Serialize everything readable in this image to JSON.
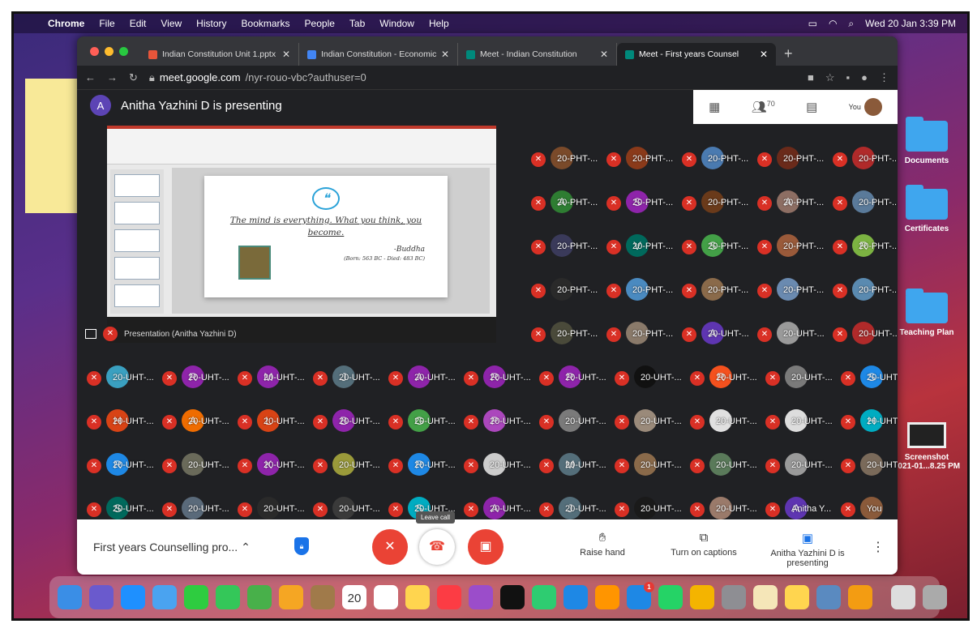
{
  "menubar": {
    "app": "Chrome",
    "items": [
      "File",
      "Edit",
      "View",
      "History",
      "Bookmarks",
      "People",
      "Tab",
      "Window",
      "Help"
    ],
    "datetime": "Wed 20 Jan  3:39 PM"
  },
  "desktop": {
    "items": [
      "Documents",
      "Certificates",
      "Teaching Plan",
      "Screenshot\n2021-01...8.25 PM"
    ]
  },
  "tabs": [
    {
      "title": "Indian Constitution Unit 1.pptx",
      "color": "#e8553a"
    },
    {
      "title": "Indian Constitution - Economic",
      "color": "#4285f4"
    },
    {
      "title": "Meet - Indian Constitution",
      "color": "#00897b"
    },
    {
      "title": "Meet - First years Counsel",
      "color": "#00897b"
    }
  ],
  "address": {
    "host": "meet.google.com",
    "path": "/nyr-rouo-vbc?authuser=0"
  },
  "meet": {
    "presenter_initial": "A",
    "presenter_text": "Anitha Yazhini D is presenting",
    "participant_count": "70",
    "you_label": "You",
    "presentation_label": "Presentation (Anitha Yazhini D)"
  },
  "slide": {
    "quote": "The mind is everything. What you think, you become.",
    "author": "-Buddha",
    "dates": "(Born: 563 BC - Died: 483 BC)"
  },
  "tiles": [
    {
      "n": "20-PHT-...",
      "c": "#7a4a2a"
    },
    {
      "n": "20-PHT-...",
      "c": "#8a3a1a"
    },
    {
      "n": "20-PHT-...",
      "c": "#4a7ab0"
    },
    {
      "n": "20-PHT-...",
      "c": "#6a2a1a"
    },
    {
      "n": "20-PHT-...",
      "c": "#b02a2a"
    },
    {
      "n": "20-PHT-...",
      "i": "A",
      "c": "#2e7d32"
    },
    {
      "n": "20-PHT-...",
      "i": "S",
      "c": "#8e24aa"
    },
    {
      "n": "20-PHT-...",
      "c": "#6a3a1a"
    },
    {
      "n": "20-PHT-...",
      "i": "A",
      "c": "#8d6e63"
    },
    {
      "n": "20-PHT-...",
      "c": "#5a7a9a"
    },
    {
      "n": "20-PHT-...",
      "c": "#3a3a5a"
    },
    {
      "n": "20-PHT-...",
      "i": "V",
      "c": "#00695c"
    },
    {
      "n": "20-PHT-...",
      "i": "S",
      "c": "#43a047"
    },
    {
      "n": "20-PHT-...",
      "c": "#9a5a3a"
    },
    {
      "n": "20-PHT-...",
      "i": "R",
      "c": "#7cb342"
    },
    {
      "n": "20-PHT-...",
      "c": "#2a2a2a"
    },
    {
      "n": "20-PHT-...",
      "c": "#4a8ac0"
    },
    {
      "n": "20-PHT-...",
      "c": "#8a6a4a"
    },
    {
      "n": "20-PHT-...",
      "c": "#6a8ab0"
    },
    {
      "n": "20-PHT-...",
      "c": "#5a8ab0"
    },
    {
      "n": "20-PHT-...",
      "c": "#4a4a3a"
    },
    {
      "n": "20-PHT-...",
      "c": "#8a7a6a"
    },
    {
      "n": "20-UHT-...",
      "i": "A",
      "c": "#5e35b1"
    },
    {
      "n": "20-UHT-...",
      "c": "#9a9a9a"
    },
    {
      "n": "20-UHT-...",
      "c": "#b02a2a"
    },
    {
      "n": "20-UHT-...",
      "c": "#3aa0c0"
    },
    {
      "n": "20-UHT-...",
      "i": "R",
      "c": "#8e24aa"
    },
    {
      "n": "20-UHT-...",
      "i": "M",
      "c": "#8e24aa"
    },
    {
      "n": "20-UHT-...",
      "i": "J",
      "c": "#546e7a"
    },
    {
      "n": "20-UHT-...",
      "i": "A",
      "c": "#8e24aa"
    },
    {
      "n": "20-UHT-...",
      "i": "R",
      "c": "#8e24aa"
    },
    {
      "n": "20-UHT-...",
      "i": "R",
      "c": "#8e24aa"
    },
    {
      "n": "20-UHT-...",
      "c": "#111"
    },
    {
      "n": "20-UHT-...",
      "i": "R",
      "c": "#f4511e"
    },
    {
      "n": "20-UHT-...",
      "c": "#7a7a7a"
    },
    {
      "n": "20-UHT-...",
      "i": "S",
      "c": "#1e88e5"
    },
    {
      "n": "20-UHT-...",
      "i": "H",
      "c": "#d84315"
    },
    {
      "n": "20-UHT-...",
      "i": "A",
      "c": "#ef6c00"
    },
    {
      "n": "20-UHT-...",
      "i": "L",
      "c": "#d84315"
    },
    {
      "n": "20-UHT-...",
      "i": "B",
      "c": "#8e24aa"
    },
    {
      "n": "20-UHT-...",
      "i": "G",
      "c": "#43a047"
    },
    {
      "n": "20-UHT-...",
      "i": "P",
      "c": "#ab47bc"
    },
    {
      "n": "20-UHT-...",
      "c": "#7a7a7a"
    },
    {
      "n": "20-UHT-...",
      "c": "#9a8a7a"
    },
    {
      "n": "20-UHT-...",
      "c": "#e0e0e0"
    },
    {
      "n": "20-UHT-...",
      "c": "#ddd"
    },
    {
      "n": "20-UHT-...",
      "i": "H",
      "c": "#00acc1"
    },
    {
      "n": "20-UHT-...",
      "i": "R",
      "c": "#1e88e5"
    },
    {
      "n": "20-UHT-...",
      "c": "#6a6a5a"
    },
    {
      "n": "20-UHT-...",
      "i": "K",
      "c": "#8e24aa"
    },
    {
      "n": "20-UHT-...",
      "c": "#9a9a3a"
    },
    {
      "n": "20-UHT-...",
      "i": "R",
      "c": "#1e88e5"
    },
    {
      "n": "20-UHT-...",
      "c": "#ccc"
    },
    {
      "n": "20-UHT-...",
      "i": "M",
      "c": "#546e7a"
    },
    {
      "n": "20-UHT-...",
      "c": "#8a6a4a"
    },
    {
      "n": "20-UHT-...",
      "c": "#5a7a5a"
    },
    {
      "n": "20-UHT-...",
      "c": "#9a9a9a"
    },
    {
      "n": "20-UHT-...",
      "c": "#7a6a5a"
    },
    {
      "n": "20-UHT-...",
      "i": "S",
      "c": "#00695c"
    },
    {
      "n": "20-UHT-...",
      "c": "#5a6a7a"
    },
    {
      "n": "20-UHT-...",
      "c": "#2a2a2a"
    },
    {
      "n": "20-UHT-...",
      "c": "#3a3a3a"
    },
    {
      "n": "20-UHT-...",
      "i": "S",
      "c": "#00acc1"
    },
    {
      "n": "20-UHT-...",
      "i": "A",
      "c": "#8e24aa"
    },
    {
      "n": "20-UHT-...",
      "i": "J",
      "c": "#546e7a"
    },
    {
      "n": "20-UHT-...",
      "c": "#1a1a1a"
    },
    {
      "n": "20-UHT-...",
      "c": "#9a7a6a"
    },
    {
      "n": "Anitha Y...",
      "i": "A",
      "c": "#5e35b1"
    },
    {
      "n": "You",
      "c": "#8a5a3a"
    }
  ],
  "bottom": {
    "meeting_title": "First years Counselling pro...",
    "leave_tooltip": "Leave call",
    "raise_hand": "Raise hand",
    "captions": "Turn on captions",
    "presenting": "Anitha Yazhini D is presenting"
  },
  "dock": {
    "calendar_day": "20",
    "badge": "1"
  }
}
